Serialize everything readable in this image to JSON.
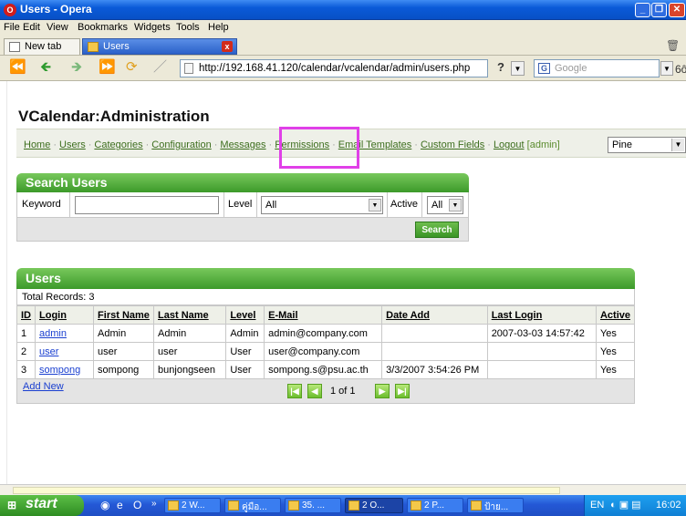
{
  "window": {
    "title": "Users - Opera"
  },
  "menubar": [
    "File",
    "Edit",
    "View",
    "Bookmarks",
    "Widgets",
    "Tools",
    "Help"
  ],
  "tabs": [
    {
      "label": "New tab"
    },
    {
      "label": "Users"
    }
  ],
  "toolbar": {
    "address": "http://192.168.41.120/calendar/vcalendar/admin/users.php",
    "search_placeholder": "Google"
  },
  "page": {
    "title": "VCalendar:Administration",
    "nav": [
      "Home",
      "Users",
      "Categories",
      "Configuration",
      "Messages",
      "Permissions",
      "Email Templates",
      "Custom Fields",
      "Logout"
    ],
    "nav_user": "[admin]",
    "style_select": "Pine"
  },
  "search": {
    "header": "Search Users",
    "keyword_label": "Keyword",
    "keyword_value": "",
    "level_label": "Level",
    "level_value": "All",
    "active_label": "Active",
    "active_value": "All",
    "button": "Search"
  },
  "users": {
    "header": "Users",
    "total_label": "Total Records:",
    "total": "3",
    "columns": [
      "ID",
      "Login",
      "First Name",
      "Last Name",
      "Level",
      "E-Mail",
      "Date Add",
      "Last Login",
      "Active"
    ],
    "rows": [
      [
        "1",
        "admin",
        "Admin",
        "Admin",
        "Admin",
        "admin@company.com",
        "",
        "2007-03-03 14:57:42",
        "Yes"
      ],
      [
        "2",
        "user",
        "user",
        "user",
        "User",
        "user@company.com",
        "",
        "",
        "Yes"
      ],
      [
        "3",
        "sompong",
        "sompong",
        "bunjongseen",
        "User",
        "sompong.s@psu.ac.th",
        "3/3/2007 3:54:26 PM",
        "",
        "Yes"
      ]
    ],
    "add_new": "Add New",
    "page_info": "1 of 1"
  },
  "taskbar": {
    "start": "start",
    "tasks": [
      "2 W...",
      "คู่มือ...",
      "35. ...",
      "2 O...",
      "2 P...",
      "ป้าย..."
    ],
    "lang": "EN",
    "clock": "16:02"
  },
  "colors": {
    "accent_green": "#3c9a2a",
    "highlight": "#e040e8",
    "link_blue": "#1a3fd0"
  }
}
